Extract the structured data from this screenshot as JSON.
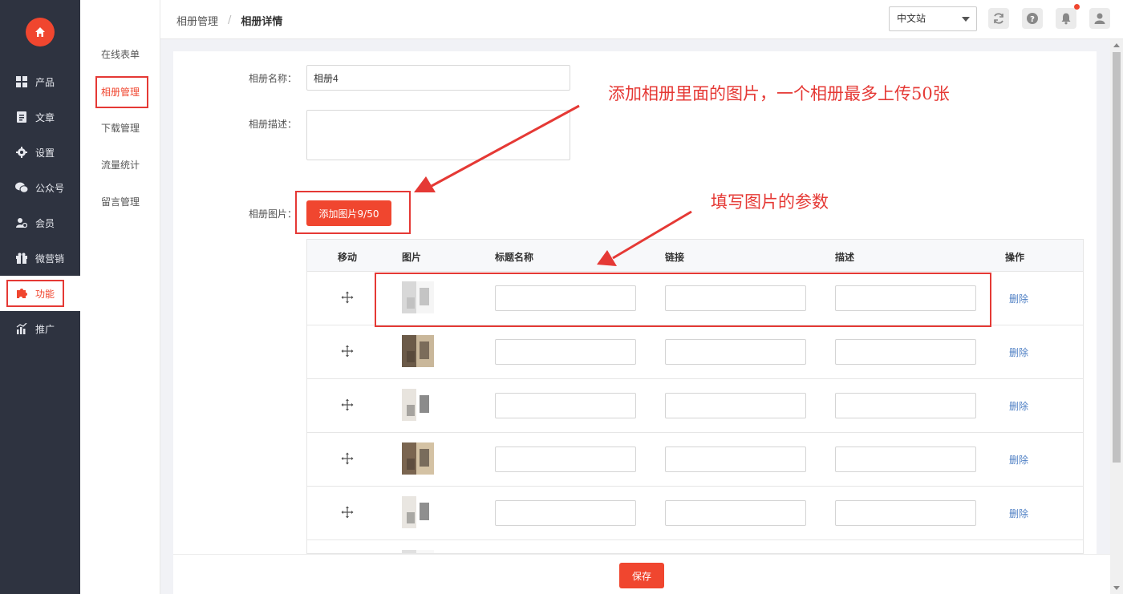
{
  "sidebar": {
    "items": [
      {
        "label": "产品",
        "icon": "grid-icon"
      },
      {
        "label": "文章",
        "icon": "document-icon"
      },
      {
        "label": "设置",
        "icon": "gear-icon"
      },
      {
        "label": "公众号",
        "icon": "wechat-icon"
      },
      {
        "label": "会员",
        "icon": "member-icon"
      },
      {
        "label": "微营销",
        "icon": "gift-icon"
      },
      {
        "label": "功能",
        "icon": "puzzle-icon",
        "active": true
      },
      {
        "label": "推广",
        "icon": "chart-icon"
      }
    ]
  },
  "subnav": {
    "items": [
      {
        "label": "在线表单"
      },
      {
        "label": "相册管理",
        "active": true
      },
      {
        "label": "下载管理"
      },
      {
        "label": "流量统计"
      },
      {
        "label": "留言管理"
      }
    ]
  },
  "header": {
    "breadcrumb_parent": "相册管理",
    "breadcrumb_current": "相册详情",
    "site_select": "中文站"
  },
  "form": {
    "name_label": "相册名称：",
    "name_value": "相册4",
    "desc_label": "相册描述：",
    "desc_value": "",
    "images_label": "相册图片：",
    "add_button": "添加图片9/50"
  },
  "table": {
    "headers": [
      "移动",
      "图片",
      "标题名称",
      "链接",
      "描述",
      "操作"
    ],
    "delete_label": "删除",
    "rows": 6
  },
  "footer": {
    "save_label": "保存"
  },
  "annotations": {
    "top_note": "添加相册里面的图片，一个相册最多上传50张",
    "mid_note": "填写图片的参数"
  },
  "colors": {
    "accent": "#f0462f",
    "sidebar": "#2e3340",
    "annotation": "#e53935",
    "link": "#4e7fc4"
  }
}
